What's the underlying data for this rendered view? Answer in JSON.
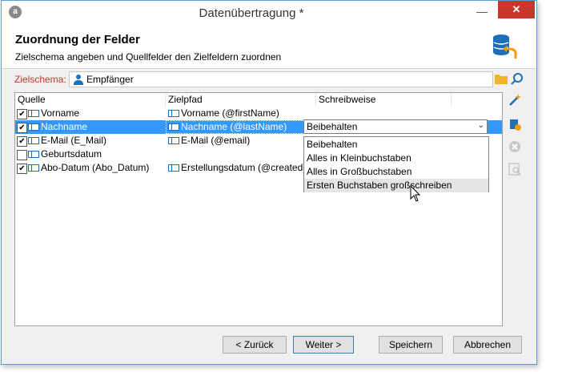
{
  "window": {
    "title": "Datenübertragung *",
    "app_icon_letter": "a",
    "close_glyph": "✕",
    "minimize_glyph": "—"
  },
  "header": {
    "title": "Zuordnung der Felder",
    "subtitle": "Zielschema angeben und Quellfelder den Zielfeldern zuordnen"
  },
  "schema": {
    "label": "Zielschema:",
    "value": "Empfänger"
  },
  "grid": {
    "columns": [
      "Quelle",
      "Zielpfad",
      "Schreibweise"
    ],
    "rows": [
      {
        "checked": true,
        "source": "Vorname",
        "target": "Vorname (@firstName)",
        "mode": "",
        "selected": false
      },
      {
        "checked": true,
        "source": "Nachname",
        "target": "Nachname (@lastName)",
        "mode": "",
        "selected": true
      },
      {
        "checked": true,
        "source": "E-Mail (E_Mail)",
        "target": "E-Mail (@email)",
        "mode": "",
        "selected": false
      },
      {
        "checked": false,
        "source": "Geburtsdatum",
        "target": "",
        "mode": "",
        "selected": false
      },
      {
        "checked": true,
        "source": "Abo-Datum (Abo_Datum)",
        "target": "Erstellungsdatum (@created)",
        "mode": "",
        "selected": false
      }
    ]
  },
  "combo": {
    "value": "Beibehalten",
    "arrow": "⌄"
  },
  "dropdown": {
    "options": [
      "Beibehalten",
      "Alles in Kleinbuchstaben",
      "Alles in Großbuchstaben",
      "Ersten Buchstaben großschreiben"
    ],
    "hover_index": 3
  },
  "side_tools": [
    "wand-icon",
    "add-field-icon",
    "remove-icon",
    "preview-icon"
  ],
  "footer": {
    "back": "< Zurück",
    "next": "Weiter >",
    "save": "Speichern",
    "cancel": "Abbrechen"
  },
  "colors": {
    "selection": "#3399ff",
    "close": "#c7372c",
    "schema_label": "#c0392b",
    "icon_blue": "#1e6fb8"
  }
}
